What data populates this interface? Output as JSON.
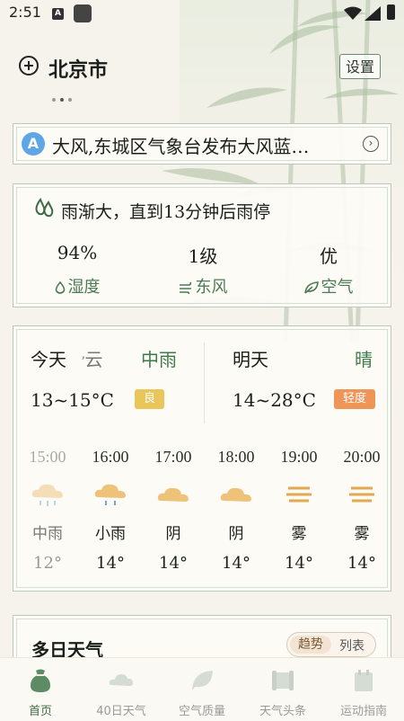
{
  "status_bar": {
    "time": "2:51",
    "notification_letter": "A"
  },
  "header": {
    "city": "北京市",
    "settings_label": "设置"
  },
  "alert": {
    "icon_letter": "A",
    "text": "大风,东城区气象台发布大风蓝…",
    "chevron": "›"
  },
  "now": {
    "rain_text": "雨渐大，直到13分钟后雨停",
    "metrics": [
      {
        "value": "94%",
        "label": "湿度",
        "icon": "droplet-icon"
      },
      {
        "value": "1级",
        "label": "东风",
        "icon": "wind-icon"
      },
      {
        "value": "优",
        "label": "空气",
        "icon": "leaf-icon"
      }
    ]
  },
  "forecast": {
    "today": {
      "label": "今天",
      "condition": "云",
      "condition2": "中雨",
      "temp": "13~15°C",
      "aqi": "良"
    },
    "tomorrow": {
      "label": "明天",
      "condition": "晴",
      "temp": "14~28°C",
      "aqi": "轻度"
    },
    "hours": [
      {
        "time": "15:00",
        "cond": "中雨",
        "temp": "12°",
        "icon": "rain-cloud-icon",
        "past": true
      },
      {
        "time": "16:00",
        "cond": "小雨",
        "temp": "14°",
        "icon": "rain-cloud-icon",
        "past": false
      },
      {
        "time": "17:00",
        "cond": "阴",
        "temp": "14°",
        "icon": "cloud-icon",
        "past": false
      },
      {
        "time": "18:00",
        "cond": "阴",
        "temp": "14°",
        "icon": "cloud-icon",
        "past": false
      },
      {
        "time": "19:00",
        "cond": "雾",
        "temp": "14°",
        "icon": "fog-icon",
        "past": false
      },
      {
        "time": "20:00",
        "cond": "雾",
        "temp": "14°",
        "icon": "fog-icon",
        "past": false
      }
    ]
  },
  "multiday": {
    "title": "多日天气",
    "tab_trend": "趋势",
    "tab_list": "列表"
  },
  "nav": [
    {
      "label": "首页",
      "icon": "home-bag-icon",
      "active": true
    },
    {
      "label": "40日天气",
      "icon": "cloud-icon",
      "active": false
    },
    {
      "label": "空气质量",
      "icon": "leaf-icon",
      "active": false
    },
    {
      "label": "天气头条",
      "icon": "scroll-icon",
      "active": false
    },
    {
      "label": "运动指南",
      "icon": "calendar-icon",
      "active": false
    }
  ],
  "colors": {
    "accent_green": "#3d6b45",
    "badge_good": "#e9c65a",
    "badge_light": "#ee9557",
    "alert_blue": "#5fa6e6"
  }
}
